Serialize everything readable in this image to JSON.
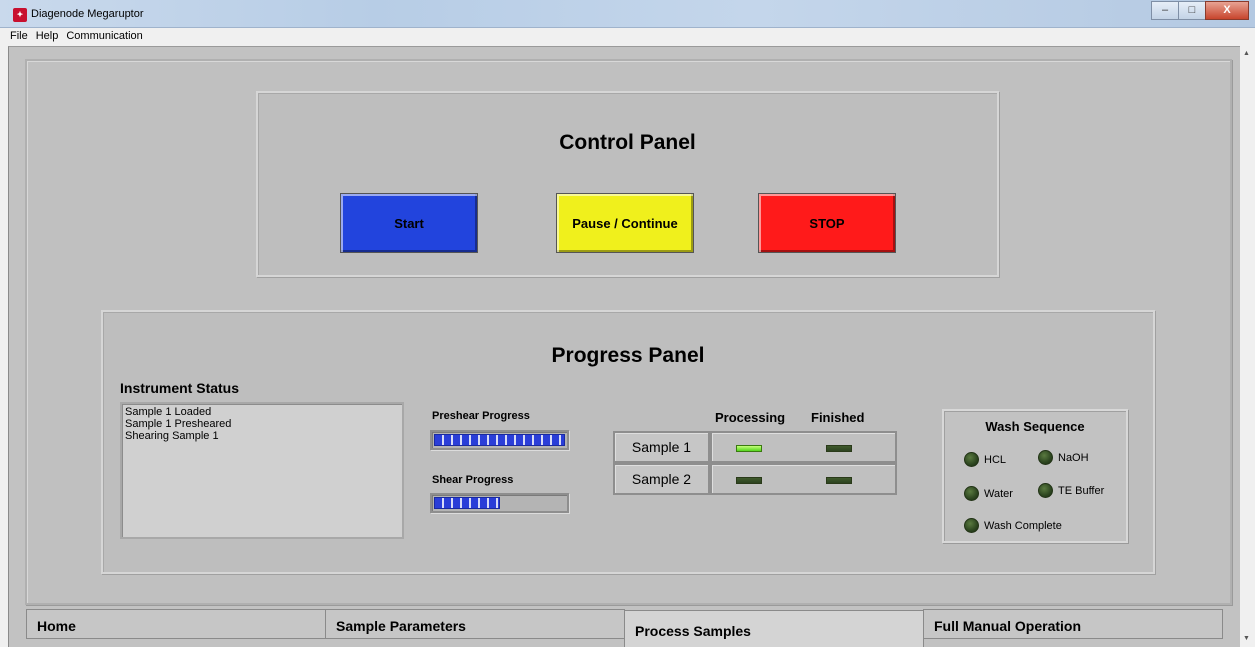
{
  "window": {
    "title": "Diagenode Megaruptor",
    "controls": {
      "minimize": "–",
      "maximize": "□",
      "close": "X"
    }
  },
  "menu": [
    "File",
    "Help",
    "Communication"
  ],
  "control_panel": {
    "title": "Control Panel",
    "buttons": {
      "start": "Start",
      "pause": "Pause / Continue",
      "stop": "STOP"
    },
    "colors": {
      "start": "#2244dd",
      "pause": "#f0f01c",
      "stop": "#ff1a1a"
    }
  },
  "progress_panel": {
    "title": "Progress Panel",
    "instrument_status": {
      "label": "Instrument Status",
      "lines": [
        "Sample 1 Loaded",
        "Sample 1 Presheared",
        "Shearing Sample 1"
      ]
    },
    "preshear": {
      "label": "Preshear Progress",
      "value": 1.0
    },
    "shear": {
      "label": "Shear Progress",
      "value": 0.5
    },
    "samples": {
      "headers": {
        "processing": "Processing",
        "finished": "Finished"
      },
      "rows": [
        {
          "name": "Sample 1",
          "processing": true,
          "finished": false
        },
        {
          "name": "Sample 2",
          "processing": false,
          "finished": false
        }
      ]
    },
    "wash": {
      "title": "Wash Sequence",
      "items": {
        "hcl": "HCL",
        "naoh": "NaOH",
        "water": "Water",
        "te_buffer": "TE Buffer",
        "complete": "Wash Complete"
      }
    }
  },
  "tabs": [
    {
      "label": "Home",
      "active": false
    },
    {
      "label": "Sample Parameters",
      "active": false
    },
    {
      "label": "Process Samples",
      "active": true
    },
    {
      "label": "Full Manual Operation",
      "active": false
    }
  ]
}
